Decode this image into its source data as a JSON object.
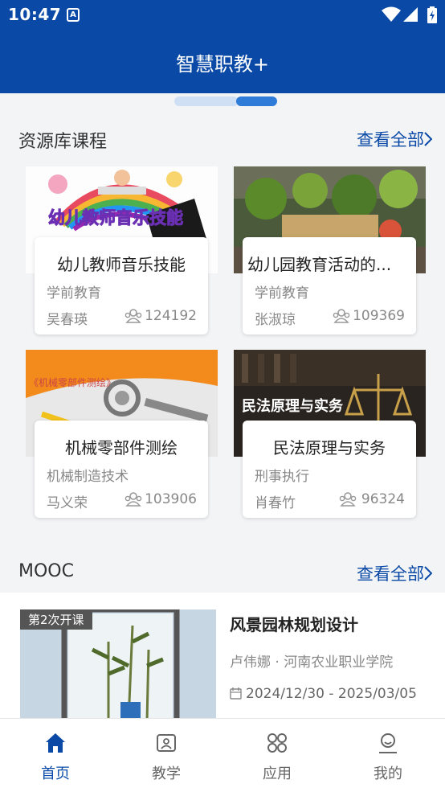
{
  "status_bar": {
    "time": "10:47",
    "notif_letter": "A"
  },
  "header": {
    "title": "智慧职教+"
  },
  "resource_section": {
    "title": "资源库课程",
    "more": "查看全部",
    "courses": [
      {
        "name": "幼儿教师音乐技能",
        "category": "学前教育",
        "teacher": "吴春瑛",
        "count": "124192",
        "thumb_text": "幼儿教师音乐技能"
      },
      {
        "name": "幼儿园教育活动的...",
        "category": "学前教育",
        "teacher": "张淑琼",
        "count": "109369"
      },
      {
        "name": "机械零部件测绘",
        "category": "机械制造技术",
        "teacher": "马义荣",
        "count": "103906",
        "thumb_text": "《机械零部件测绘》"
      },
      {
        "name": "民法原理与实务",
        "category": "刑事执行",
        "teacher": "肖春竹",
        "count": "96324",
        "thumb_text": "民法原理与实务"
      }
    ]
  },
  "mooc_section": {
    "title": "MOOC",
    "more": "查看全部",
    "item": {
      "badge": "第2次开课",
      "name": "风景园林规划设计",
      "teacher_school": "卢伟娜 · 河南农业职业学院",
      "date": "2024/12/30 - 2025/03/05"
    }
  },
  "bottom_nav": [
    {
      "label": "首页",
      "icon": "home-icon",
      "active": true
    },
    {
      "label": "教学",
      "icon": "teaching-icon",
      "active": false
    },
    {
      "label": "应用",
      "icon": "apps-icon",
      "active": false
    },
    {
      "label": "我的",
      "icon": "profile-icon",
      "active": false
    }
  ],
  "colors": {
    "primary": "#0a4aa6",
    "accent": "#2f7bd8"
  }
}
